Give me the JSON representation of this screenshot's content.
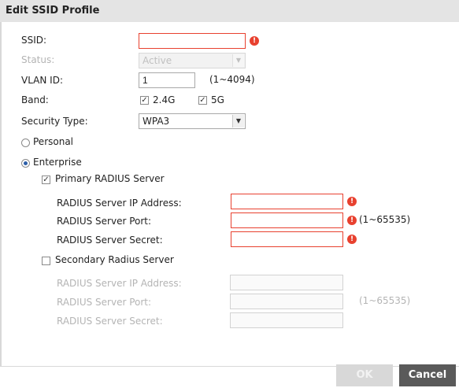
{
  "dialog": {
    "title": "Edit SSID Profile"
  },
  "form": {
    "ssid_label": "SSID:",
    "ssid_value": "",
    "status_label": "Status:",
    "status_value": "Active",
    "vlan_label": "VLAN ID:",
    "vlan_value": "1",
    "vlan_range": "(1~4094)",
    "band_label": "Band:",
    "band_options": [
      {
        "label": "2.4G",
        "checked": true
      },
      {
        "label": "5G",
        "checked": true
      }
    ],
    "security_label": "Security Type:",
    "security_value": "WPA3",
    "personal_label": "Personal",
    "enterprise_label": "Enterprise",
    "selected_mode": "Enterprise"
  },
  "primary": {
    "label": "Primary RADIUS Server",
    "checked": true,
    "ip_label": "RADIUS Server IP Address:",
    "port_label": "RADIUS Server Port:",
    "port_range": "(1~65535)",
    "secret_label": "RADIUS Server Secret:",
    "ip_value": "",
    "port_value": "",
    "secret_value": ""
  },
  "secondary": {
    "label": "Secondary Radius Server",
    "checked": false,
    "ip_label": "RADIUS Server IP Address:",
    "port_label": "RADIUS Server Port:",
    "port_range": "(1~65535)",
    "secret_label": "RADIUS Server Secret:"
  },
  "buttons": {
    "ok": "OK",
    "cancel": "Cancel"
  },
  "colors": {
    "error": "#e8412f",
    "cancel_bg": "#5a5a5a",
    "ok_disabled_bg": "#d8d8d8",
    "radio_dot": "#2d5fa8"
  },
  "icons": {
    "error": "exclamation-circle-icon",
    "checked": "check-mark",
    "dropdown": "chevron-down-icon"
  }
}
